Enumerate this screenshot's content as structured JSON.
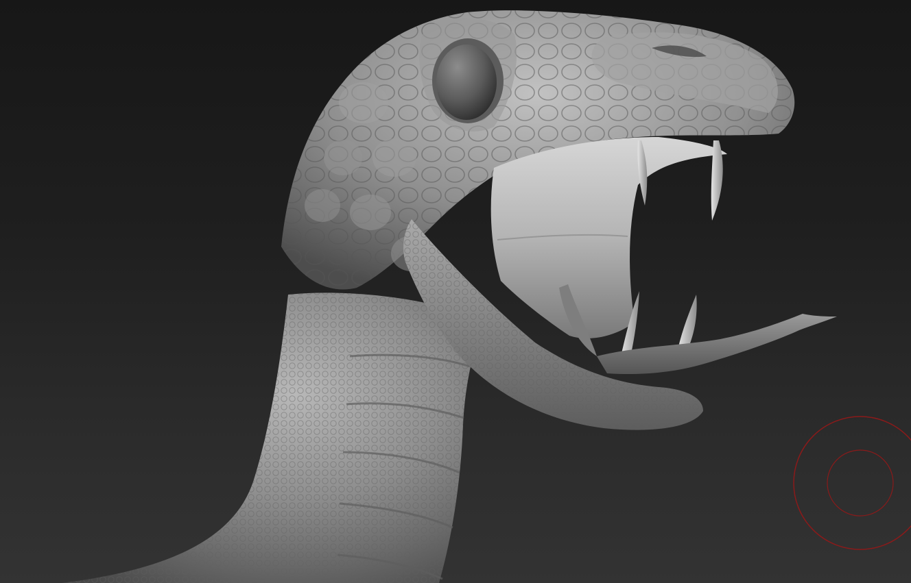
{
  "viewport": {
    "background_top": "#171717",
    "background_bottom": "#333333"
  },
  "model": {
    "material_color": "#8a8a8a",
    "highlight_color": "#b5b5b5",
    "shadow_color": "#4a4a4a"
  },
  "brush_cursor": {
    "color": "#8b1a1a"
  }
}
